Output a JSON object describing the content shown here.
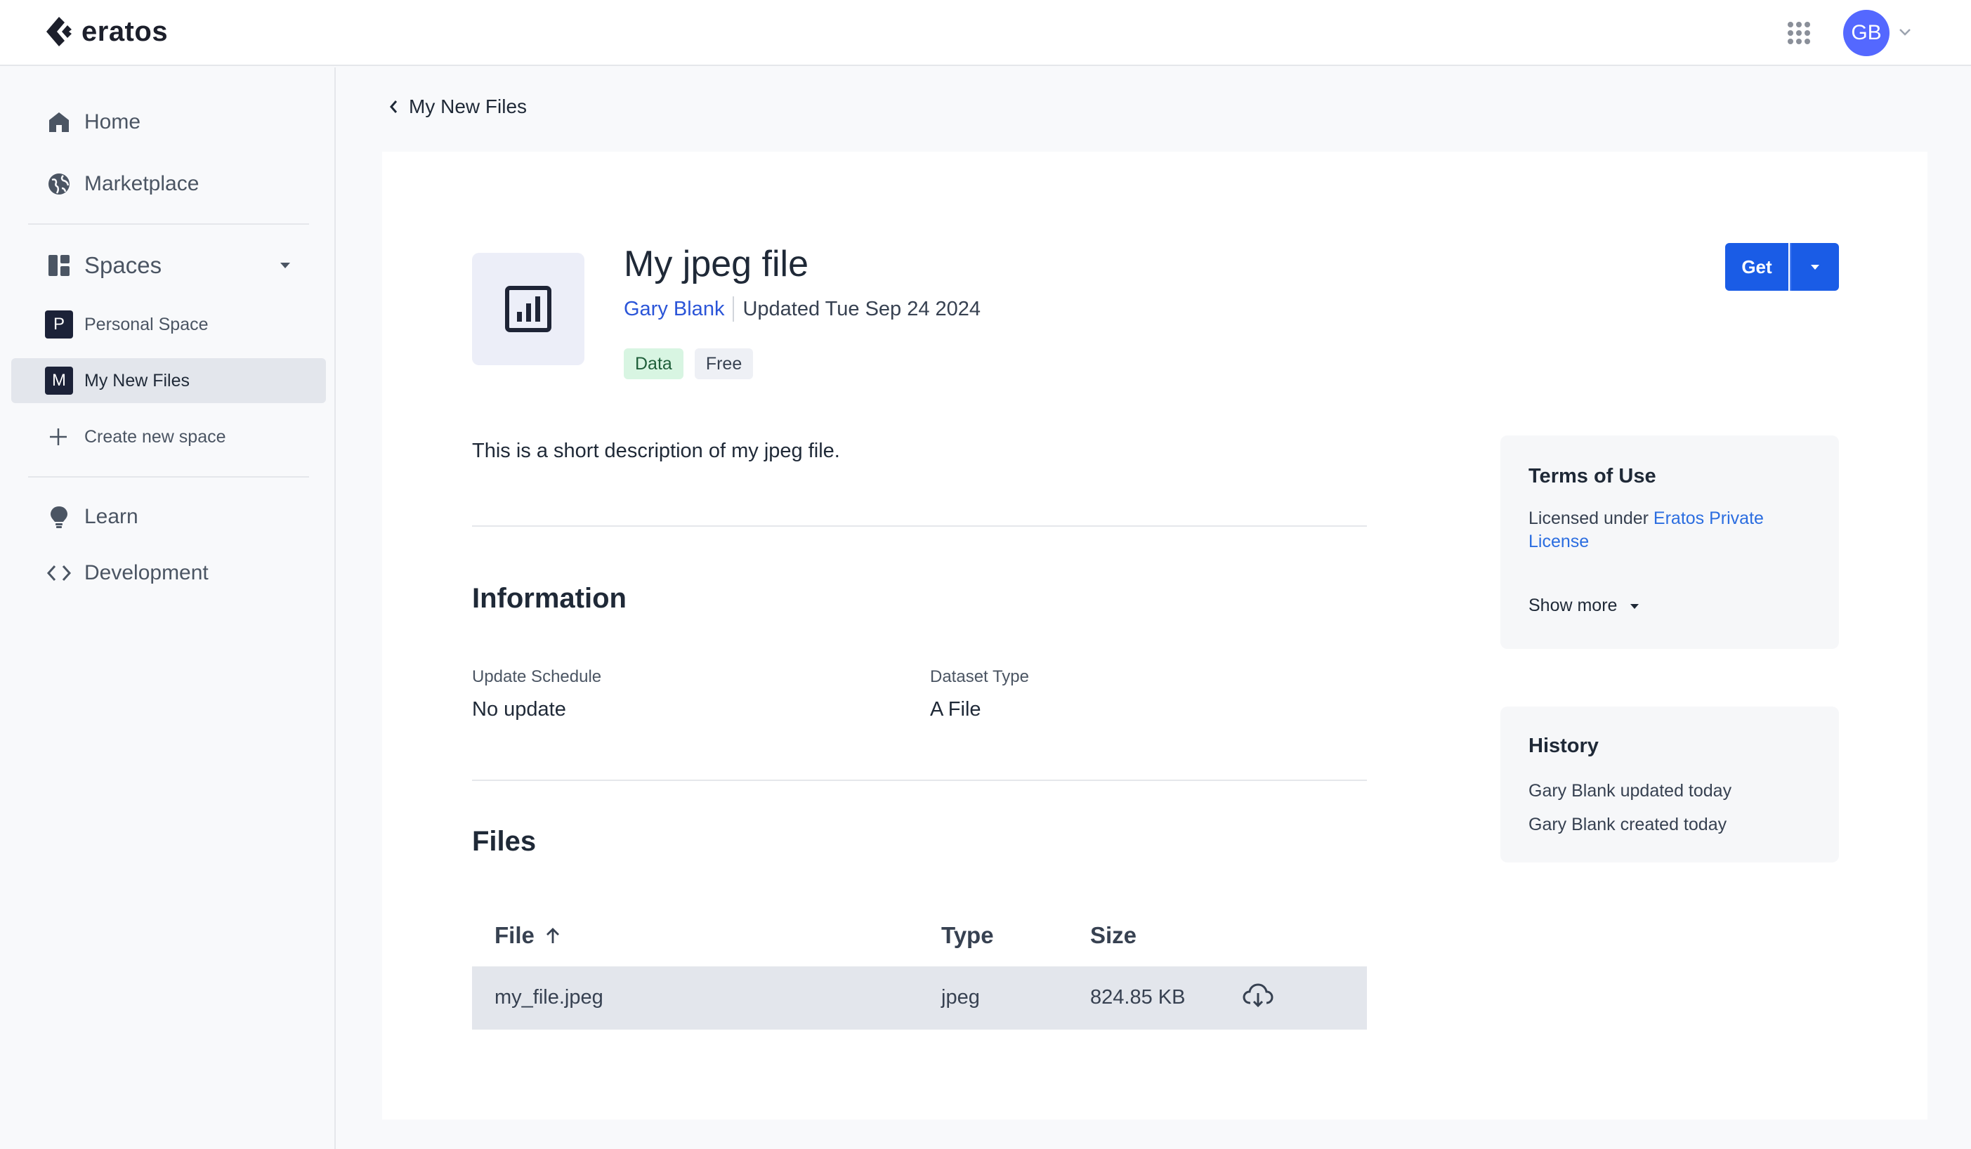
{
  "app": {
    "logo_text": "eratos",
    "avatar_initials": "GB"
  },
  "sidebar": {
    "home": "Home",
    "marketplace": "Marketplace",
    "spaces": "Spaces",
    "personal_space": {
      "badge": "P",
      "label": "Personal Space"
    },
    "my_new_files": {
      "badge": "M",
      "label": "My New Files"
    },
    "create_new_space": "Create new space",
    "learn": "Learn",
    "development": "Development"
  },
  "breadcrumb": {
    "back_label": "My New Files"
  },
  "resource": {
    "title": "My jpeg file",
    "author": "Gary Blank",
    "updated": "Updated Tue Sep 24 2024",
    "tags": [
      "Data",
      "Free"
    ],
    "get_label": "Get",
    "description": "This is a short description of my jpeg file."
  },
  "information": {
    "title": "Information",
    "update_schedule_label": "Update Schedule",
    "update_schedule_value": "No update",
    "dataset_type_label": "Dataset Type",
    "dataset_type_value": "A File"
  },
  "files": {
    "title": "Files",
    "columns": [
      "File",
      "Type",
      "Size"
    ],
    "rows": [
      {
        "file": "my_file.jpeg",
        "type": "jpeg",
        "size": "824.85 KB"
      }
    ]
  },
  "terms": {
    "title": "Terms of Use",
    "licensed_prefix": "Licensed under",
    "license_link": "Eratos Private License",
    "show_more": "Show more"
  },
  "history": {
    "title": "History",
    "entries": [
      "Gary Blank updated today",
      "Gary Blank created today"
    ]
  },
  "colors": {
    "accent": "#1a5ce6",
    "avatar": "#5468ff",
    "link": "#2b55d8"
  }
}
